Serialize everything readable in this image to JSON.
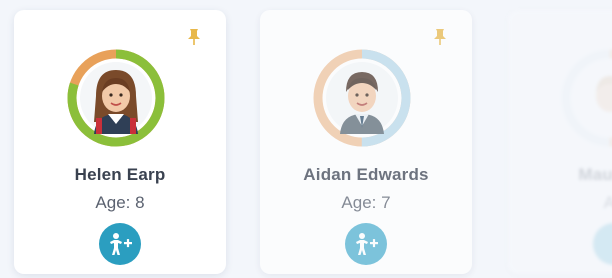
{
  "children": [
    {
      "name": "Helen Earp",
      "age_label": "Age: 8",
      "pinned": true,
      "progress": 0.8,
      "ring_colors": {
        "primary": "#8bbf3a",
        "secondary": "#e8a15a"
      },
      "avatar_icon": "girl-avatar",
      "add_icon": "add-child-icon"
    },
    {
      "name": "Aidan Edwards",
      "age_label": "Age: 7",
      "pinned": true,
      "progress": 0.5,
      "ring_colors": {
        "primary": "#b9d9ea",
        "secondary": "#f0c39c"
      },
      "avatar_icon": "boy-avatar",
      "add_icon": "add-child-icon"
    },
    {
      "name": "Maureen",
      "age_label": "Ag",
      "pinned": false,
      "progress": 0.5,
      "ring_colors": {
        "primary": "#f0c39c",
        "secondary": "#e6eef2"
      },
      "avatar_icon": "child-avatar",
      "add_icon": "add-child-icon"
    }
  ],
  "colors": {
    "accent": "#2b9ec0",
    "pin": "#e8b84a",
    "name_text": "#3a4250",
    "age_text": "#5b6270"
  }
}
